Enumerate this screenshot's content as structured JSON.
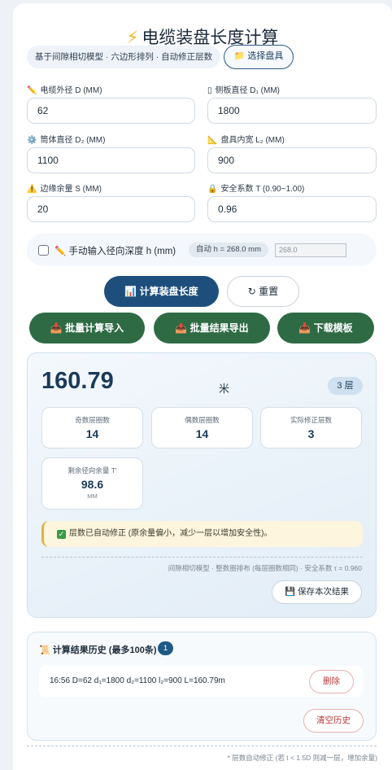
{
  "header": {
    "title": "电缆装盘长度计算",
    "title_icon": "lightning-icon",
    "subtitle": "基于间隙相切模型 · 六边形排列 · 自动修正层数",
    "select_reel_label": "选择盘具"
  },
  "fields": [
    {
      "icon": "✏️",
      "label": "电缆外径 D (MM)",
      "value": "62"
    },
    {
      "icon": "▯",
      "label": "侧板直径 D₁ (MM)",
      "value": "1800"
    },
    {
      "icon": "⚙️",
      "label": "筒体直径 D₂ (MM)",
      "value": "1100"
    },
    {
      "icon": "📐",
      "label": "盘具内宽 L₂ (MM)",
      "value": "900"
    },
    {
      "icon": "⚠️",
      "label": "边缘余量 S (MM)",
      "value": "20"
    },
    {
      "icon": "🔒",
      "label": "安全系数 T (0.90~1.00)",
      "value": "0.96"
    }
  ],
  "manual": {
    "label": "手动输入径向深度 h (mm)",
    "auto_text": "自动 h = 268.0 mm",
    "input_placeholder": "268.0",
    "checked": false
  },
  "actions": {
    "calculate": "📊 计算装盘长度",
    "reset": "↻ 重置",
    "batch_import": "📥 批量计算导入",
    "batch_export": "📤 批量结果导出",
    "download_template": "📥 下载模板"
  },
  "result": {
    "length": "160.79",
    "unit": "米",
    "layers_badge": "3 层",
    "stats": [
      {
        "label": "奇数层圈数",
        "value": "14"
      },
      {
        "label": "偶数层圈数",
        "value": "14"
      },
      {
        "label": "实际修正层数",
        "value": "3"
      }
    ],
    "remaining": {
      "label": "剩余径向余量 T'",
      "value": "98.6",
      "unit": "MM"
    },
    "notice": "层数已自动修正 (原余量偏小，减少一层以增加安全性)。",
    "model_note": "间隙相切模型 · 整数圈排布 (每层圈数相同) · 安全系数 τ = 0.960",
    "save_label": "💾 保存本次结果"
  },
  "history": {
    "title": "📜 计算结果历史 (最多100条)",
    "count": "1",
    "items": [
      {
        "text": "16:56 D=62 d₁=1800 d₂=1100 l₂=900 L=160.79m",
        "delete_label": "删除"
      }
    ],
    "clear_label": "清空历史"
  },
  "footer_note": "* 层数自动修正 (若 t < 1.5D 则减一层，增加余量)",
  "colors": {
    "primary": "#1e4f7c",
    "green": "#2e6b45",
    "danger": "#b83a3a",
    "accent": "#f3b61f"
  }
}
